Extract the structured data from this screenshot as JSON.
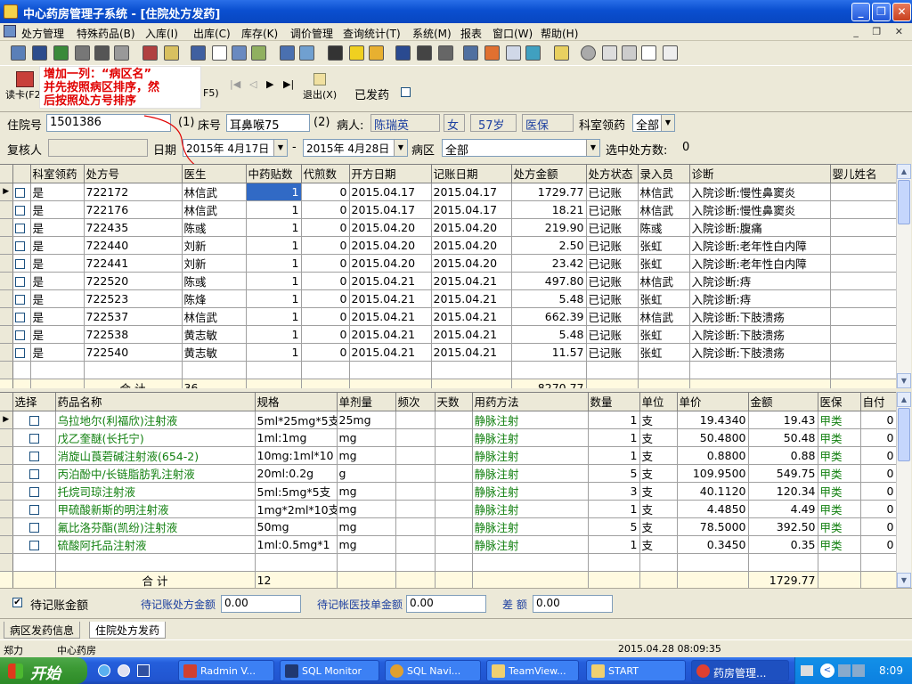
{
  "window": {
    "title": "中心药房管理子系统 - [住院处方发药]"
  },
  "menu": [
    "处方管理",
    "特殊药品(B)",
    "入库(I)",
    "出库(C)",
    "库存(K)",
    "调价管理",
    "查询统计(T)",
    "系统(M)",
    "报表",
    "窗口(W)",
    "帮助(H)"
  ],
  "annotation": {
    "line1": "增加一列：“病区名”",
    "line2": "并先按照病区排序，然",
    "line3": "后按照处方号排序"
  },
  "commands": {
    "read_card": "读卡(F2",
    "f5": "F5)",
    "exit": "退出(X)",
    "dispensed": "已发药"
  },
  "form": {
    "inpatient_no_label": "住院号",
    "inpatient_no": "1501386",
    "c1": "(1)",
    "bed_label": "床号",
    "bed_value": "耳鼻喉75",
    "c2": "(2)",
    "patient_label": "病人:",
    "patient_name": "陈瑞英",
    "gender": "女",
    "age": "57岁",
    "insurance": "医保",
    "dept_collect_label": "科室领药",
    "dept_collect": "全部",
    "reviewer_label": "复核人",
    "date_label": "日期",
    "date_from": "2015年 4月17日",
    "dash": "-",
    "date_to": "2015年 4月28日",
    "ward_label": "病区",
    "ward": "全部",
    "selected_label": "选中处方数:",
    "selected_count": "0"
  },
  "rx_table": {
    "headers": [
      "科室领药",
      "处方号",
      "医生",
      "中药贴数",
      "代煎数",
      "开方日期",
      "记账日期",
      "处方金额",
      "处方状态",
      "录入员",
      "诊断",
      "婴儿姓名"
    ],
    "rows": [
      [
        "是",
        "722172",
        "林信武",
        "1",
        "0",
        "2015.04.17",
        "2015.04.17",
        "1729.77",
        "已记账",
        "林信武",
        "入院诊断:慢性鼻窦炎",
        ""
      ],
      [
        "是",
        "722176",
        "林信武",
        "1",
        "0",
        "2015.04.17",
        "2015.04.17",
        "18.21",
        "已记账",
        "林信武",
        "入院诊断:慢性鼻窦炎",
        ""
      ],
      [
        "是",
        "722435",
        "陈彧",
        "1",
        "0",
        "2015.04.20",
        "2015.04.20",
        "219.90",
        "已记账",
        "陈彧",
        "入院诊断:腹痛",
        ""
      ],
      [
        "是",
        "722440",
        "刘新",
        "1",
        "0",
        "2015.04.20",
        "2015.04.20",
        "2.50",
        "已记账",
        "张虹",
        "入院诊断:老年性白内障",
        ""
      ],
      [
        "是",
        "722441",
        "刘新",
        "1",
        "0",
        "2015.04.20",
        "2015.04.20",
        "23.42",
        "已记账",
        "张虹",
        "入院诊断:老年性白内障",
        ""
      ],
      [
        "是",
        "722520",
        "陈彧",
        "1",
        "0",
        "2015.04.21",
        "2015.04.21",
        "497.80",
        "已记账",
        "林信武",
        "入院诊断:痔",
        ""
      ],
      [
        "是",
        "722523",
        "陈烽",
        "1",
        "0",
        "2015.04.21",
        "2015.04.21",
        "5.48",
        "已记账",
        "张虹",
        "入院诊断:痔",
        ""
      ],
      [
        "是",
        "722537",
        "林信武",
        "1",
        "0",
        "2015.04.21",
        "2015.04.21",
        "662.39",
        "已记账",
        "林信武",
        "入院诊断:下肢溃疡",
        ""
      ],
      [
        "是",
        "722538",
        "黄志敏",
        "1",
        "0",
        "2015.04.21",
        "2015.04.21",
        "5.48",
        "已记账",
        "张虹",
        "入院诊断:下肢溃疡",
        ""
      ],
      [
        "是",
        "722540",
        "黄志敏",
        "1",
        "0",
        "2015.04.21",
        "2015.04.21",
        "11.57",
        "已记账",
        "张虹",
        "入院诊断:下肢溃疡",
        ""
      ]
    ],
    "sum_label": "合  计",
    "sum_count": "36",
    "sum_amount": "8270.77"
  },
  "drug_table": {
    "headers": [
      "选择",
      "药品名称",
      "规格",
      "单剂量",
      "频次",
      "天数",
      "用药方法",
      "数量",
      "单位",
      "单价",
      "金额",
      "医保",
      "自付"
    ],
    "rows": [
      [
        "",
        "乌拉地尔(利福欣)注射液",
        "5ml*25mg*5支",
        "25mg",
        "",
        "",
        "静脉注射",
        "1",
        "支",
        "19.4340",
        "19.43",
        "甲类",
        "0"
      ],
      [
        "",
        "戊乙奎醚(长托宁)",
        "1ml:1mg",
        "mg",
        "",
        "",
        "静脉注射",
        "1",
        "支",
        "50.4800",
        "50.48",
        "甲类",
        "0"
      ],
      [
        "",
        "消旋山莨菪碱注射液(654-2)",
        "10mg:1ml*10",
        "mg",
        "",
        "",
        "静脉注射",
        "1",
        "支",
        "0.8800",
        "0.88",
        "甲类",
        "0"
      ],
      [
        "",
        "丙泊酚中/长链脂肪乳注射液",
        "20ml:0.2g",
        "g",
        "",
        "",
        "静脉注射",
        "5",
        "支",
        "109.9500",
        "549.75",
        "甲类",
        "0"
      ],
      [
        "",
        "托烷司琼注射液",
        "5ml:5mg*5支",
        "mg",
        "",
        "",
        "静脉注射",
        "3",
        "支",
        "40.1120",
        "120.34",
        "甲类",
        "0"
      ],
      [
        "",
        "甲硫酸新斯的明注射液",
        "1mg*2ml*10支",
        "mg",
        "",
        "",
        "静脉注射",
        "1",
        "支",
        "4.4850",
        "4.49",
        "甲类",
        "0"
      ],
      [
        "",
        "氟比洛芬酯(凯纷)注射液",
        "50mg",
        "mg",
        "",
        "",
        "静脉注射",
        "5",
        "支",
        "78.5000",
        "392.50",
        "甲类",
        "0"
      ],
      [
        "",
        "硫酸阿托品注射液",
        "1ml:0.5mg*1",
        "mg",
        "",
        "",
        "静脉注射",
        "1",
        "支",
        "0.3450",
        "0.35",
        "甲类",
        "0"
      ]
    ],
    "sum_label": "合  计",
    "sum_count": "12",
    "sum_amount": "1729.77"
  },
  "bottom": {
    "pending_label": "待记账金额",
    "pending_rx_label": "待记账处方金额",
    "pending_rx": "0.00",
    "pending_order_label": "待记帐医技单金额",
    "pending_order": "0.00",
    "diff_label": "差 额",
    "diff": "0.00"
  },
  "tabs": [
    "病区发药信息",
    "住院处方发药"
  ],
  "status": {
    "location": "郑力",
    "pharmacy": "中心药房",
    "datetime": "2015.04.28 08:09:35"
  },
  "taskbar": {
    "start": "开始",
    "tasks": [
      "Radmin V...",
      "SQL Monitor",
      "SQL Navi...",
      "TeamView...",
      "START",
      "药房管理..."
    ],
    "clock": "8:09"
  }
}
